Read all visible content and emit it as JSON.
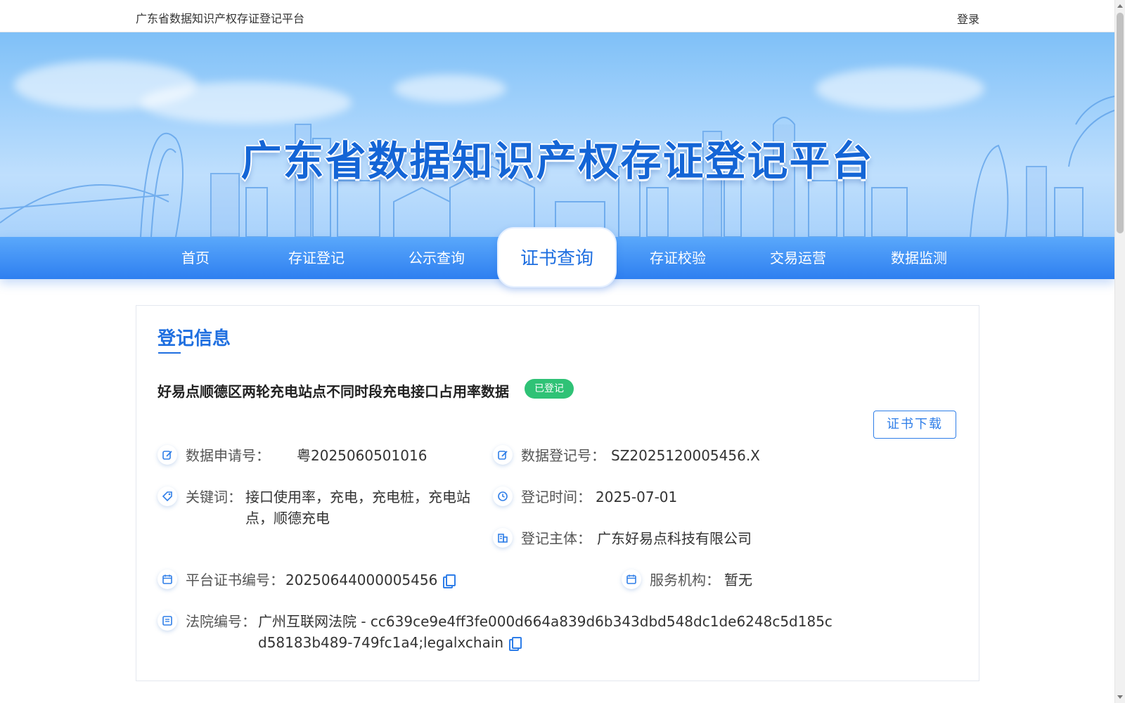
{
  "topbar": {
    "site_name": "广东省数据知识产权存证登记平台",
    "login_label": "登录"
  },
  "hero": {
    "title": "广东省数据知识产权存证登记平台"
  },
  "nav": {
    "items": [
      {
        "label": "首页"
      },
      {
        "label": "存证登记"
      },
      {
        "label": "公示查询"
      },
      {
        "label": "证书查询",
        "active": true
      },
      {
        "label": "存证校验"
      },
      {
        "label": "交易运营"
      },
      {
        "label": "数据监测"
      }
    ]
  },
  "card": {
    "section_title": "登记信息",
    "data_title": "好易点顺德区两轮充电站点不同时段充电接口占用率数据",
    "status": "已登记",
    "download_label": "证书下载",
    "fields": {
      "application_no": {
        "label": "数据申请号：",
        "value": "粤2025060501016"
      },
      "registration_no": {
        "label": "数据登记号：",
        "value": "SZ2025120005456.X"
      },
      "keywords": {
        "label": "关键词：",
        "value": "接口使用率，充电，充电桩，充电站点，顺德充电"
      },
      "registration_time": {
        "label": "登记时间：",
        "value": "2025-07-01"
      },
      "registrant": {
        "label": "登记主体：",
        "value": "广东好易点科技有限公司"
      },
      "cert_no": {
        "label": "平台证书编号：",
        "value": "20250644000005456"
      },
      "service_org": {
        "label": "服务机构：",
        "value": "暂无"
      },
      "court_no": {
        "label": "法院编号：",
        "value": "广州互联网法院 - cc639ce9e4ff3fe000d664a839d6b343dbd548dc1de6248c5d185cd58183b489-749fc1a4;legalxchain"
      }
    }
  },
  "colors": {
    "accent": "#1f6fe0",
    "nav_bg": "#2e7ff0",
    "status_green": "#2fc276"
  }
}
